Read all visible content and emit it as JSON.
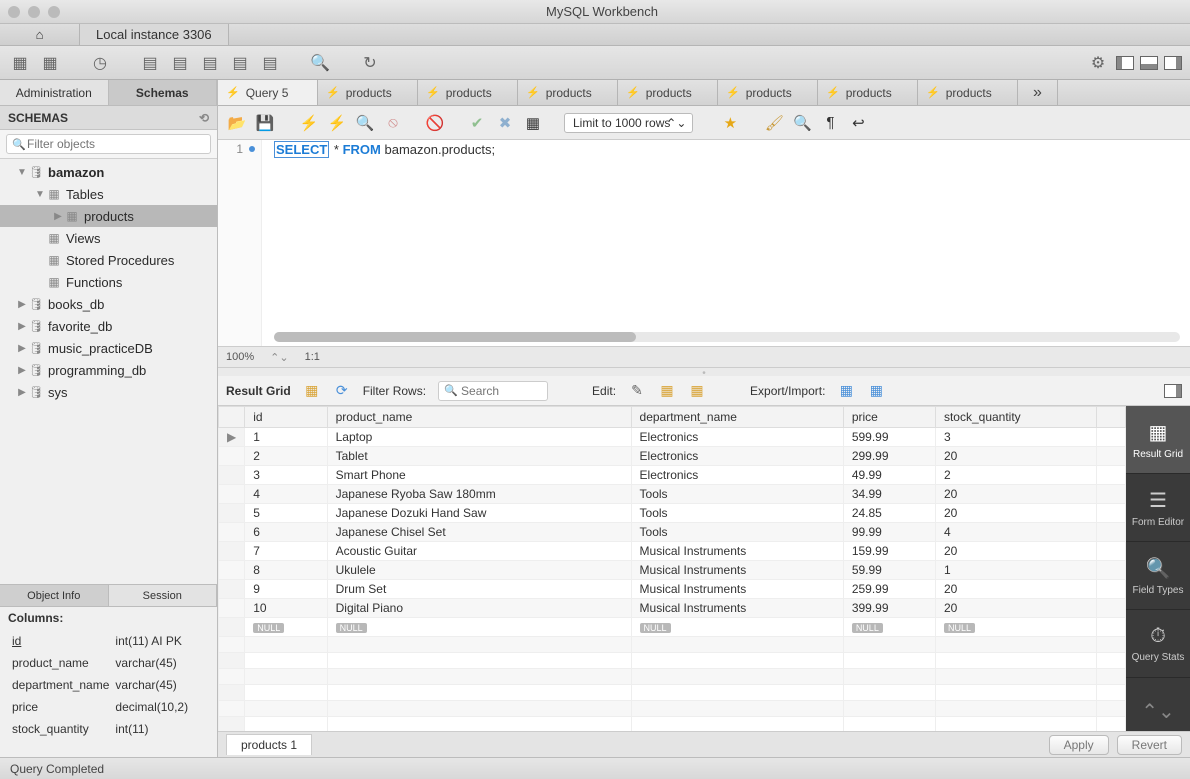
{
  "window": {
    "title": "MySQL Workbench"
  },
  "filetab": {
    "label": "Local instance 3306"
  },
  "sidebar_tabs": {
    "admin": "Administration",
    "schemas": "Schemas"
  },
  "schemas_header": "SCHEMAS",
  "filter_placeholder": "Filter objects",
  "tree": {
    "bamazon": "bamazon",
    "tables": "Tables",
    "products": "products",
    "views": "Views",
    "stored_procs": "Stored Procedures",
    "functions": "Functions",
    "dbs": [
      "books_db",
      "favorite_db",
      "music_practiceDB",
      "programming_db",
      "sys"
    ]
  },
  "sb_bottom_tabs": {
    "object_info": "Object Info",
    "session": "Session"
  },
  "colinfo": {
    "title": "Columns:",
    "rows": [
      {
        "name": "id",
        "type": "int(11) AI PK",
        "underline": true
      },
      {
        "name": "product_name",
        "type": "varchar(45)"
      },
      {
        "name": "department_name",
        "type": "varchar(45)"
      },
      {
        "name": "price",
        "type": "decimal(10,2)"
      },
      {
        "name": "stock_quantity",
        "type": "int(11)"
      }
    ]
  },
  "query_tabs": [
    "Query 5",
    "products",
    "products",
    "products",
    "products",
    "products",
    "products",
    "products"
  ],
  "limit_label": "Limit to 1000 rows",
  "editor": {
    "line_no": "1",
    "kw_select": "SELECT",
    "star": " * ",
    "kw_from": "FROM",
    "rest": " bamazon.products;"
  },
  "zoom": {
    "pct": "100%",
    "ratio": "1:1"
  },
  "result_toolbar": {
    "label": "Result Grid",
    "filter_label": "Filter Rows:",
    "search_placeholder": "Search",
    "edit_label": "Edit:",
    "export_label": "Export/Import:"
  },
  "grid": {
    "headers": [
      "id",
      "product_name",
      "department_name",
      "price",
      "stock_quantity"
    ],
    "rows": [
      [
        "1",
        "Laptop",
        "Electronics",
        "599.99",
        "3"
      ],
      [
        "2",
        "Tablet",
        "Electronics",
        "299.99",
        "20"
      ],
      [
        "3",
        "Smart Phone",
        "Electronics",
        "49.99",
        "2"
      ],
      [
        "4",
        "Japanese Ryoba Saw 180mm",
        "Tools",
        "34.99",
        "20"
      ],
      [
        "5",
        "Japanese Dozuki Hand Saw",
        "Tools",
        "24.85",
        "20"
      ],
      [
        "6",
        "Japanese Chisel Set",
        "Tools",
        "99.99",
        "4"
      ],
      [
        "7",
        "Acoustic Guitar",
        "Musical Instruments",
        "159.99",
        "20"
      ],
      [
        "8",
        "Ukulele",
        "Musical Instruments",
        "59.99",
        "1"
      ],
      [
        "9",
        "Drum Set",
        "Musical Instruments",
        "259.99",
        "20"
      ],
      [
        "10",
        "Digital Piano",
        "Musical Instruments",
        "399.99",
        "20"
      ]
    ],
    "null": "NULL"
  },
  "rrail": {
    "result_grid": "Result Grid",
    "form_editor": "Form Editor",
    "field_types": "Field Types",
    "query_stats": "Query Stats"
  },
  "result_tab": "products 1",
  "apply": "Apply",
  "revert": "Revert",
  "status": "Query Completed"
}
